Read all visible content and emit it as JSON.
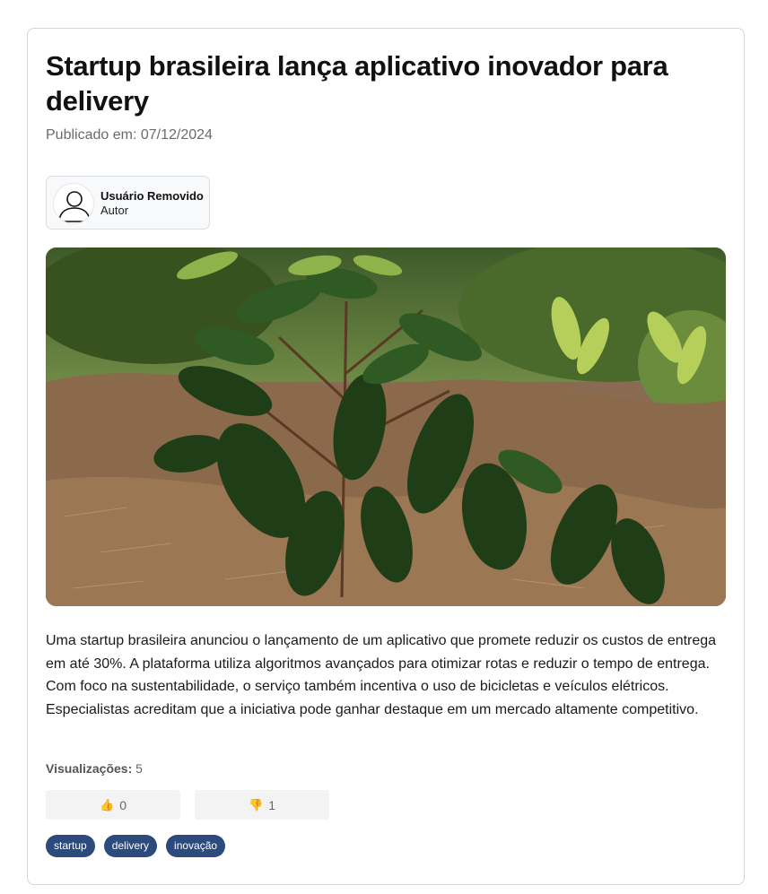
{
  "article": {
    "title": "Startup brasileira lança aplicativo inovador para delivery",
    "published_label": "Publicado em: 07/12/2024",
    "author": {
      "name": "Usuário Removido",
      "role": "Autor",
      "avatar_icon": "user-silhouette-icon"
    },
    "image": {
      "subject": "young-plant-photo"
    },
    "body": "Uma startup brasileira anunciou o lançamento de um aplicativo que promete reduzir os custos de entrega em até 30%. A plataforma utiliza algoritmos avançados para otimizar rotas e reduzir o tempo de entrega. Com foco na sustentabilidade, o serviço também incentiva o uso de bicicletas e veículos elétricos. Especialistas acreditam que a iniciativa pode ganhar destaque em um mercado altamente competitivo.",
    "views": {
      "label": "Visualizações:",
      "value": "5"
    },
    "votes": {
      "like": {
        "icon": "👍",
        "count": "0"
      },
      "dislike": {
        "icon": "👎",
        "count": "1"
      }
    },
    "tags": [
      "startup",
      "delivery",
      "inovação"
    ]
  },
  "colors": {
    "tag_bg": "#2c4a7c",
    "card_border": "#d6d6d6",
    "muted_text": "#6b6b6b"
  }
}
